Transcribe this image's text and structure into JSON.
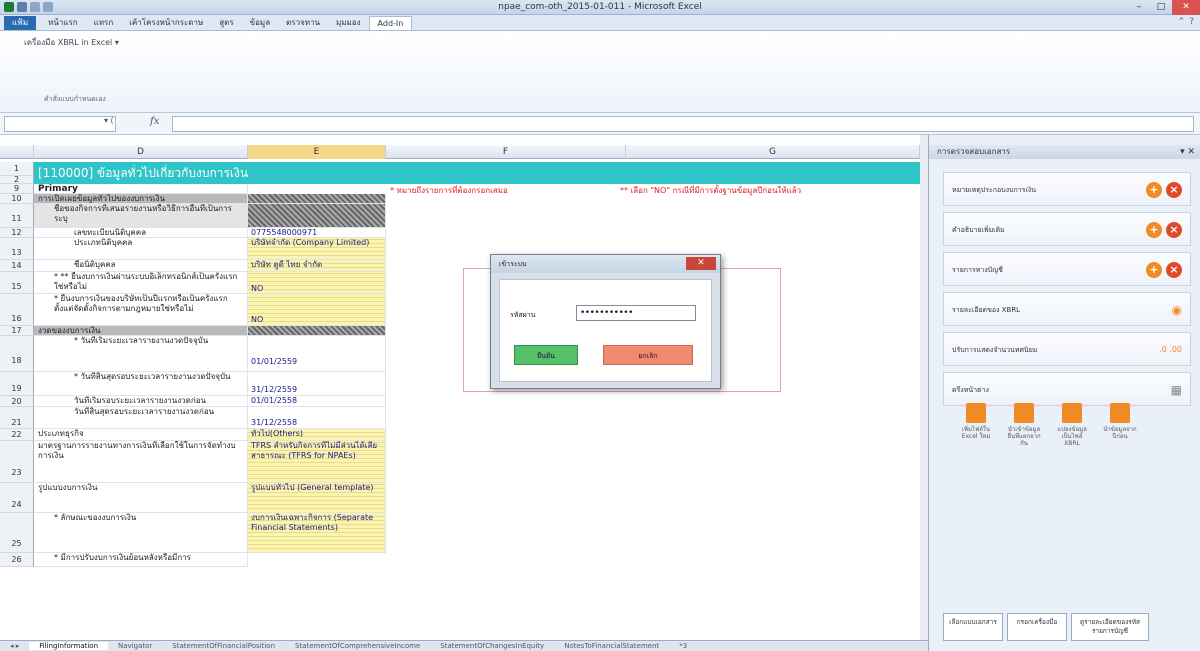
{
  "window": {
    "title": "npae_com-oth_2015-01-011 - Microsoft Excel",
    "min": "–",
    "max": "□",
    "close": "✕"
  },
  "ribbon_tabs": [
    "แฟ้ม",
    "หน้าแรก",
    "แทรก",
    "เค้าโครงหน้ากระดาษ",
    "สูตร",
    "ข้อมูล",
    "ตรวจทาน",
    "มุมมอง",
    "Add-In"
  ],
  "ribbon": {
    "xbrl_button": "เครื่องมือ XBRL in Excel ▾",
    "group_label": "คำสั่งแบบกำหนดเอง"
  },
  "formula_bar": {
    "name_box": "",
    "dropdown": "▾ ( ",
    "fx": "fx"
  },
  "columns": [
    "D",
    "E",
    "F",
    "G"
  ],
  "banner": "[110000] ข้อมูลทั่วไปเกี่ยวกับงบการเงิน",
  "notes": {
    "required": "* หมายถึงรายการที่ต้องกรอกเสมอ",
    "no_hint": "** เลือก \"NO\" กรณีที่มีการตั้งฐานข้อมูลปีก่อนให้แล้ว"
  },
  "rows": [
    {
      "n": "1",
      "d": "",
      "e": ""
    },
    {
      "n": "2",
      "d": "",
      "e": ""
    },
    {
      "n": "9",
      "d": "Primary",
      "e": ""
    },
    {
      "n": "10",
      "d": "การเปิดเผยข้อมูลทั่วไปของงบการเงิน",
      "e": ""
    },
    {
      "n": "11",
      "d": "ชื่อของกิจการที่เสนอรายงานหรือวิธีการอื่นที่เป็นการระบุ",
      "e": ""
    },
    {
      "n": "12",
      "d": "เลขทะเบียนนิติบุคคล",
      "e": "0775548000971"
    },
    {
      "n": "13",
      "d": "ประเภทนิติบุคคล",
      "e": "บริษัทจำกัด (Company Limited)"
    },
    {
      "n": "14",
      "d": "ชื่อนิติบุคคล",
      "e": "บริษัท ดูดี ไทย จำกัด"
    },
    {
      "n": "15",
      "d": "* ** ยื่นงบการเงินผ่านระบบอิเล็กทรอนิกส์เป็นครั้งแรกใช่หรือไม่",
      "e": "NO"
    },
    {
      "n": "16",
      "d": "* ยื่นงบการเงินของบริษัทเป็นปีแรกหรือเป็นครั้งแรกตั้งแต่จัดตั้งกิจการตามกฎหมายใช่หรือไม่",
      "e": "NO"
    },
    {
      "n": "17",
      "d": "งวดของงบการเงิน",
      "e": ""
    },
    {
      "n": "18",
      "d": "* วันที่เริ่มระยะเวลารายงานงวดปัจจุบัน",
      "e": "01/01/2559"
    },
    {
      "n": "19",
      "d": "* วันที่สิ้นสุดรอบระยะเวลารายงานงวดปัจจุบัน",
      "e": "31/12/2559"
    },
    {
      "n": "20",
      "d": "วันที่เริ่มรอบระยะเวลารายงานงวดก่อน",
      "e": "01/01/2558"
    },
    {
      "n": "21",
      "d": "วันที่สิ้นสุดรอบระยะเวลารายงานงวดก่อน",
      "e": "31/12/2558"
    },
    {
      "n": "22",
      "d": "ประเภทธุรกิจ",
      "e": "ทั่วไป(Others)"
    },
    {
      "n": "23",
      "d": "มาตรฐานการรายงานทางการเงินที่เลือกใช้ในการจัดทำงบการเงิน",
      "e": "TFRS สำหรับกิจการที่ไม่มีส่วนได้เสียสาธารณะ (TFRS for NPAEs)"
    },
    {
      "n": "24",
      "d": "รูปแบบงบการเงิน",
      "e": "รูปแบบทั่วไป (General template)"
    },
    {
      "n": "25",
      "d": "* ลักษณะของงบการเงิน",
      "e": "งบการเงินเฉพาะกิจการ (Separate Financial Statements)"
    },
    {
      "n": "26",
      "d": "* มีการปรับงบการเงินย้อนหลังหรือมีการ",
      "e": ""
    }
  ],
  "sheet_tabs": [
    "FilingInformation",
    "Navigator",
    "StatementOfFinancialPosition",
    "StatementOfComprehensiveIncome",
    "StatementOfChangesInEquity",
    "NotesToFinancialStatement",
    "*3"
  ],
  "pane": {
    "title": "การตรวจสอบเอกสาร",
    "close": "▾ ✕",
    "items": [
      "หมายเหตุประกอบงบการเงิน",
      "คำอธิบายเพิ่มเติม",
      "รายการทางบัญชี",
      "รายละเอียดของ XBRL",
      "ปรับการแสดงจำนวนทศนิยม",
      "ตรึงหน้าต่าง"
    ],
    "decimals": ".0 .00",
    "actions": [
      "เพิ่มไฟล์ใน Excel ใหม่",
      "นำเข้าข้อมูลอื่นที่แยกจากกัน",
      "แปลงข้อมูลเป็นไฟล์ XBRL",
      "นำข้อมูลจากปีก่อน"
    ],
    "bottom_buttons": [
      "เลือกแบบเอกสาร",
      "กรอกเครื่องมือ",
      "ดูรายละเอียดของรหัสรายการบัญชี"
    ]
  },
  "dialog": {
    "title": "เข้าระบบ",
    "close": "✕",
    "password_label": "รหัสผ่าน",
    "password_value": "•••••••••••",
    "ok": "ยืนยัน",
    "cancel": "ยกเลิก"
  },
  "colors": {
    "banner": "#2ec4c8",
    "accent_orange": "#f08a24",
    "ok_green": "#55c06a",
    "cancel_red": "#ef8a70"
  }
}
